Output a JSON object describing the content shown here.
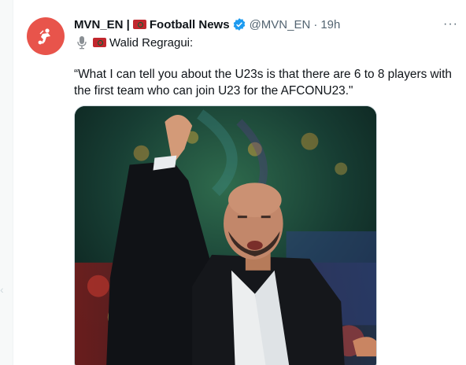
{
  "tweet": {
    "display_name": "MVN_EN |",
    "display_name_2": "Football News",
    "handle": "@MVN_EN",
    "separator": "·",
    "time": "19h",
    "more": "···",
    "speaker_line": "Walid Regragui:",
    "text": "“What I can tell you about the U23s is that there are 6 to 8 players with the first team who can join U23 for the AFCONU23.\""
  },
  "colors": {
    "avatar_bg": "#e8544b",
    "verified": "#1d9bf0",
    "flag_red": "#c1272d",
    "flag_green": "#006233"
  },
  "icons": {
    "avatar": "football-player-logo",
    "verified": "verified-badge-icon",
    "mic": "microphone-icon",
    "flag": "morocco-flag-icon",
    "more": "more-options-icon"
  }
}
